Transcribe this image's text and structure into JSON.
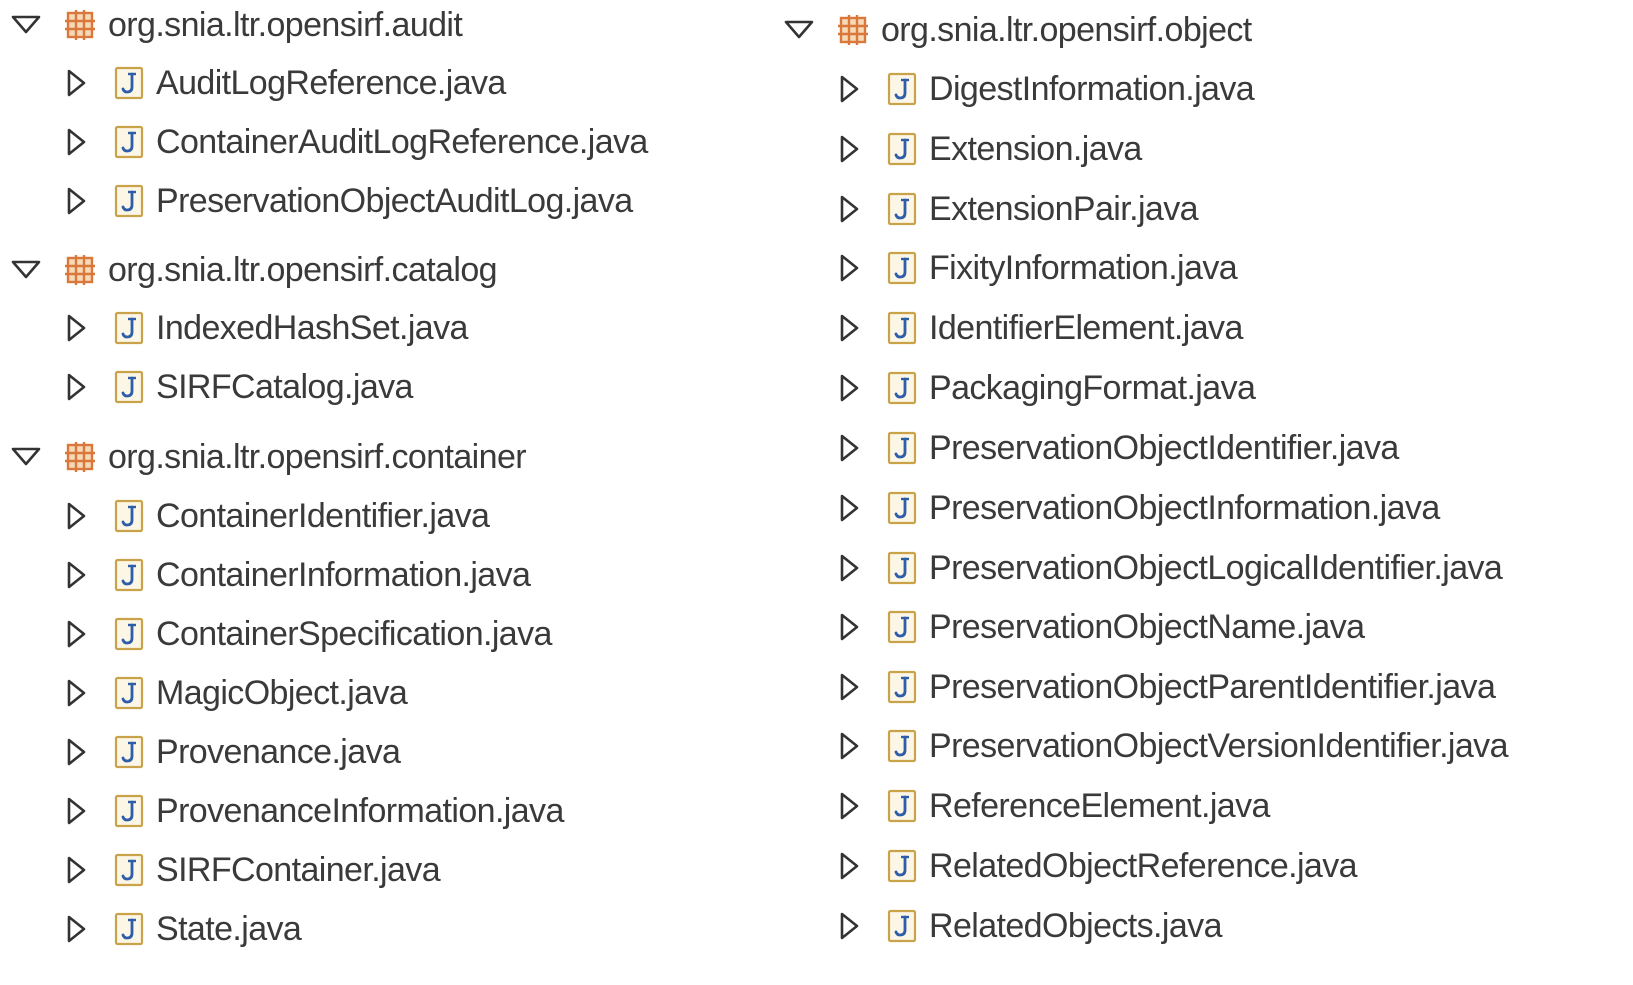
{
  "left_tree": {
    "packages": [
      {
        "name": "org.snia.ltr.opensirf.audit",
        "files": [
          "AuditLogReference.java",
          "ContainerAuditLogReference.java",
          "PreservationObjectAuditLog.java"
        ]
      },
      {
        "name": "org.snia.ltr.opensirf.catalog",
        "files": [
          "IndexedHashSet.java",
          "SIRFCatalog.java"
        ]
      },
      {
        "name": "org.snia.ltr.opensirf.container",
        "files": [
          "ContainerIdentifier.java",
          "ContainerInformation.java",
          "ContainerSpecification.java",
          "MagicObject.java",
          "Provenance.java",
          "ProvenanceInformation.java",
          "SIRFContainer.java",
          "State.java"
        ]
      }
    ]
  },
  "right_tree": {
    "packages": [
      {
        "name": "org.snia.ltr.opensirf.object",
        "files": [
          "DigestInformation.java",
          "Extension.java",
          "ExtensionPair.java",
          "FixityInformation.java",
          "IdentifierElement.java",
          "PackagingFormat.java",
          "PreservationObjectIdentifier.java",
          "PreservationObjectInformation.java",
          "PreservationObjectLogicalIdentifier.java",
          "PreservationObjectName.java",
          "PreservationObjectParentIdentifier.java",
          "PreservationObjectVersionIdentifier.java",
          "ReferenceElement.java",
          "RelatedObjectReference.java",
          "RelatedObjects.java"
        ]
      }
    ]
  },
  "icons": {
    "package": "package-icon",
    "java_file": "java-file-icon",
    "expanded": "expanded-triangle-icon",
    "collapsed": "collapsed-triangle-icon"
  },
  "colors": {
    "package_icon": "#d9783a",
    "java_icon_border": "#c9a24a",
    "java_icon_letter": "#2f5ea8",
    "text": "#3a3a3a",
    "triangle": "#333333"
  }
}
